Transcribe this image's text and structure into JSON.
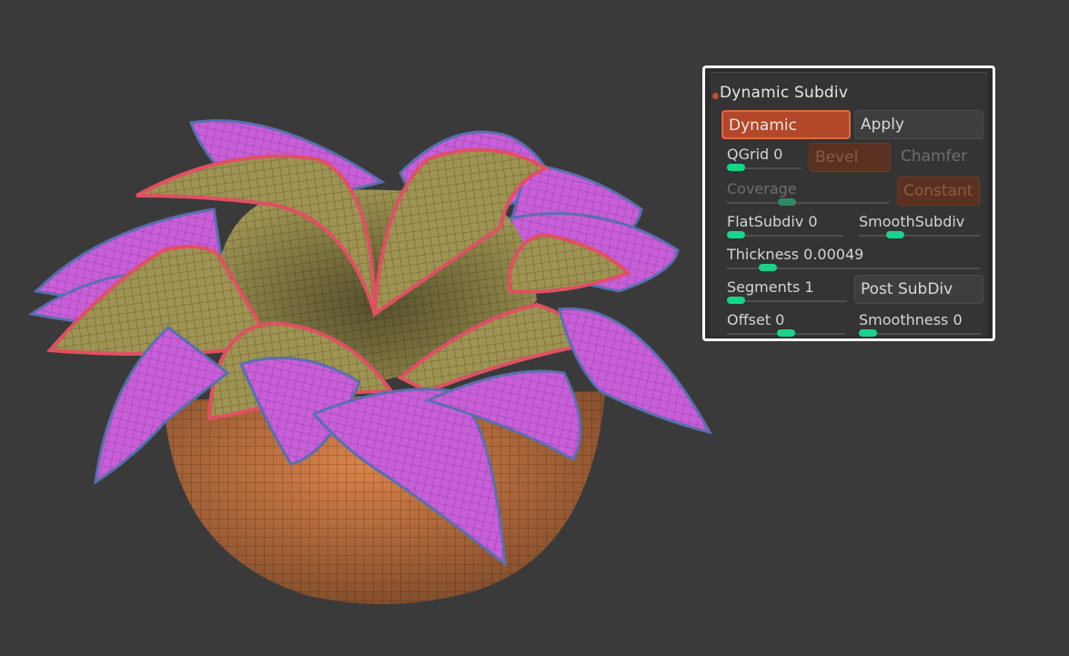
{
  "panel": {
    "title": "Dynamic Subdiv",
    "buttons": {
      "dynamic": "Dynamic",
      "apply": "Apply",
      "bevel": "Bevel",
      "chamfer": "Chamfer",
      "constant": "Constant",
      "post_subdiv": "Post SubDiv"
    },
    "sliders": {
      "qgrid": {
        "label": "QGrid 0",
        "level": 0.0
      },
      "coverage": {
        "label": "Coverage",
        "level": 0.5
      },
      "flat_subdiv": {
        "label": "FlatSubdiv 0",
        "level": 0.0
      },
      "smooth_subdiv": {
        "label": "SmoothSubdiv",
        "level": 0.25
      },
      "thickness": {
        "label": "Thickness 0.00049",
        "level": 0.15
      },
      "segments": {
        "label": "Segments 1",
        "level": 0.0
      },
      "offset": {
        "label": "Offset 0",
        "level": 0.5
      },
      "smoothness": {
        "label": "Smoothness 0",
        "level": 0.0
      }
    }
  },
  "colors": {
    "viewport_bg": "#3a3a3a",
    "accent_orange": "#b2472a",
    "slider_knob": "#19d38c",
    "petal_magenta": "#c85fd8",
    "petal_olive": "#9c8f52",
    "bowl_orange": "#d9824a"
  }
}
